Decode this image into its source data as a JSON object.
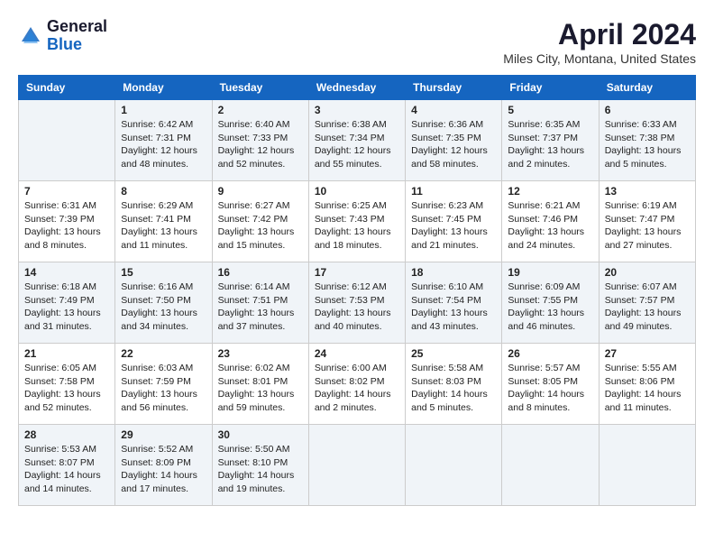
{
  "header": {
    "logo_general": "General",
    "logo_blue": "Blue",
    "month_title": "April 2024",
    "location": "Miles City, Montana, United States"
  },
  "days_of_week": [
    "Sunday",
    "Monday",
    "Tuesday",
    "Wednesday",
    "Thursday",
    "Friday",
    "Saturday"
  ],
  "weeks": [
    [
      {
        "day": "",
        "info": ""
      },
      {
        "day": "1",
        "info": "Sunrise: 6:42 AM\nSunset: 7:31 PM\nDaylight: 12 hours\nand 48 minutes."
      },
      {
        "day": "2",
        "info": "Sunrise: 6:40 AM\nSunset: 7:33 PM\nDaylight: 12 hours\nand 52 minutes."
      },
      {
        "day": "3",
        "info": "Sunrise: 6:38 AM\nSunset: 7:34 PM\nDaylight: 12 hours\nand 55 minutes."
      },
      {
        "day": "4",
        "info": "Sunrise: 6:36 AM\nSunset: 7:35 PM\nDaylight: 12 hours\nand 58 minutes."
      },
      {
        "day": "5",
        "info": "Sunrise: 6:35 AM\nSunset: 7:37 PM\nDaylight: 13 hours\nand 2 minutes."
      },
      {
        "day": "6",
        "info": "Sunrise: 6:33 AM\nSunset: 7:38 PM\nDaylight: 13 hours\nand 5 minutes."
      }
    ],
    [
      {
        "day": "7",
        "info": "Sunrise: 6:31 AM\nSunset: 7:39 PM\nDaylight: 13 hours\nand 8 minutes."
      },
      {
        "day": "8",
        "info": "Sunrise: 6:29 AM\nSunset: 7:41 PM\nDaylight: 13 hours\nand 11 minutes."
      },
      {
        "day": "9",
        "info": "Sunrise: 6:27 AM\nSunset: 7:42 PM\nDaylight: 13 hours\nand 15 minutes."
      },
      {
        "day": "10",
        "info": "Sunrise: 6:25 AM\nSunset: 7:43 PM\nDaylight: 13 hours\nand 18 minutes."
      },
      {
        "day": "11",
        "info": "Sunrise: 6:23 AM\nSunset: 7:45 PM\nDaylight: 13 hours\nand 21 minutes."
      },
      {
        "day": "12",
        "info": "Sunrise: 6:21 AM\nSunset: 7:46 PM\nDaylight: 13 hours\nand 24 minutes."
      },
      {
        "day": "13",
        "info": "Sunrise: 6:19 AM\nSunset: 7:47 PM\nDaylight: 13 hours\nand 27 minutes."
      }
    ],
    [
      {
        "day": "14",
        "info": "Sunrise: 6:18 AM\nSunset: 7:49 PM\nDaylight: 13 hours\nand 31 minutes."
      },
      {
        "day": "15",
        "info": "Sunrise: 6:16 AM\nSunset: 7:50 PM\nDaylight: 13 hours\nand 34 minutes."
      },
      {
        "day": "16",
        "info": "Sunrise: 6:14 AM\nSunset: 7:51 PM\nDaylight: 13 hours\nand 37 minutes."
      },
      {
        "day": "17",
        "info": "Sunrise: 6:12 AM\nSunset: 7:53 PM\nDaylight: 13 hours\nand 40 minutes."
      },
      {
        "day": "18",
        "info": "Sunrise: 6:10 AM\nSunset: 7:54 PM\nDaylight: 13 hours\nand 43 minutes."
      },
      {
        "day": "19",
        "info": "Sunrise: 6:09 AM\nSunset: 7:55 PM\nDaylight: 13 hours\nand 46 minutes."
      },
      {
        "day": "20",
        "info": "Sunrise: 6:07 AM\nSunset: 7:57 PM\nDaylight: 13 hours\nand 49 minutes."
      }
    ],
    [
      {
        "day": "21",
        "info": "Sunrise: 6:05 AM\nSunset: 7:58 PM\nDaylight: 13 hours\nand 52 minutes."
      },
      {
        "day": "22",
        "info": "Sunrise: 6:03 AM\nSunset: 7:59 PM\nDaylight: 13 hours\nand 56 minutes."
      },
      {
        "day": "23",
        "info": "Sunrise: 6:02 AM\nSunset: 8:01 PM\nDaylight: 13 hours\nand 59 minutes."
      },
      {
        "day": "24",
        "info": "Sunrise: 6:00 AM\nSunset: 8:02 PM\nDaylight: 14 hours\nand 2 minutes."
      },
      {
        "day": "25",
        "info": "Sunrise: 5:58 AM\nSunset: 8:03 PM\nDaylight: 14 hours\nand 5 minutes."
      },
      {
        "day": "26",
        "info": "Sunrise: 5:57 AM\nSunset: 8:05 PM\nDaylight: 14 hours\nand 8 minutes."
      },
      {
        "day": "27",
        "info": "Sunrise: 5:55 AM\nSunset: 8:06 PM\nDaylight: 14 hours\nand 11 minutes."
      }
    ],
    [
      {
        "day": "28",
        "info": "Sunrise: 5:53 AM\nSunset: 8:07 PM\nDaylight: 14 hours\nand 14 minutes."
      },
      {
        "day": "29",
        "info": "Sunrise: 5:52 AM\nSunset: 8:09 PM\nDaylight: 14 hours\nand 17 minutes."
      },
      {
        "day": "30",
        "info": "Sunrise: 5:50 AM\nSunset: 8:10 PM\nDaylight: 14 hours\nand 19 minutes."
      },
      {
        "day": "",
        "info": ""
      },
      {
        "day": "",
        "info": ""
      },
      {
        "day": "",
        "info": ""
      },
      {
        "day": "",
        "info": ""
      }
    ]
  ]
}
